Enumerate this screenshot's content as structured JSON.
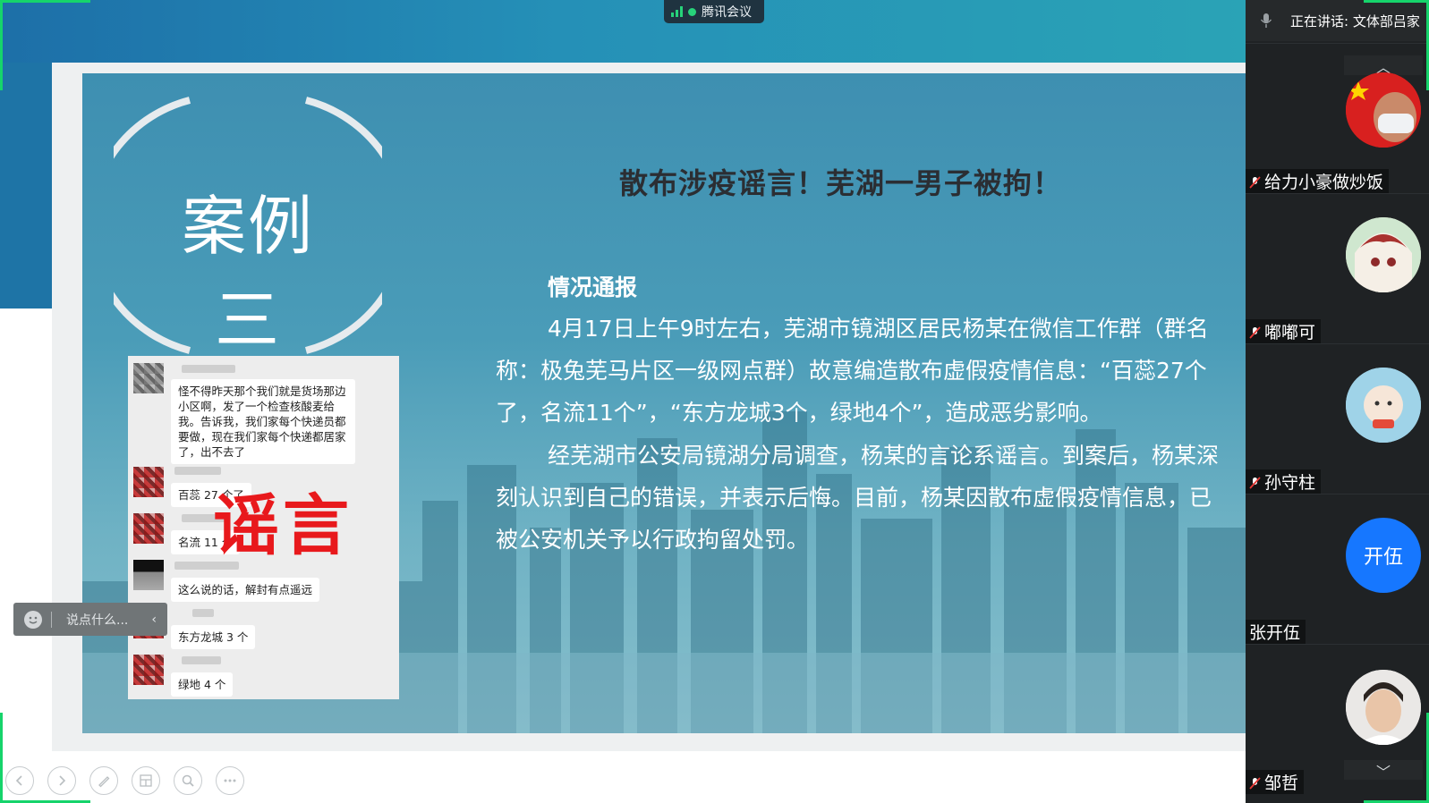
{
  "app": {
    "name": "腾讯会议"
  },
  "colors": {
    "accent_green": "#16d46b",
    "blue_avatar": "#1677ff",
    "rumor_red": "#e8191c"
  },
  "slide": {
    "case_title": "案例三",
    "headline": "散布涉疫谣言！芜湖一男子被拘！",
    "section_title": "情况通报",
    "paragraph1": "4月17日上午9时左右，芜湖市镜湖区居民杨某在微信工作群（群名称：极兔芜马片区一级网点群）故意编造散布虚假疫情信息：“百蕊27个了，名流11个”，“东方龙城3个，绿地4个”，造成恶劣影响。",
    "paragraph2": "经芜湖市公安局镜湖分局调查，杨某的言论系谣言。到案后，杨某深刻认识到自己的错误，并表示后悔。目前，杨某因散布虚假疫情信息，已被公安机关予以行政拘留处罚。",
    "chat": {
      "messages": [
        "怪不得昨天那个我们就是货场那边小区啊，发了一个检查核酸麦给我。告诉我，我们家每个快递员都要做，现在我们家每个快递都居家了，出不去了",
        "百蕊 27 个了",
        "名流 11 个",
        "这么说的话，解封有点遥远",
        "东方龙城 3 个",
        "绿地 4 个"
      ],
      "stamp": "谣言"
    }
  },
  "comment_box": {
    "placeholder": "说点什么..."
  },
  "toolbar": {
    "icons": [
      "prev-icon",
      "next-icon",
      "pen-icon",
      "layout-icon",
      "zoom-icon",
      "more-icon"
    ]
  },
  "panel": {
    "speaking_label": "正在讲话: 文体部吕家",
    "participants": [
      {
        "name": "给力小豪做炒饭",
        "muted": true,
        "avatar": "flag-mask"
      },
      {
        "name": "嘟嘟可",
        "muted": true,
        "avatar": "anime-girl"
      },
      {
        "name": "孙守柱",
        "muted": true,
        "avatar": "cartoon"
      },
      {
        "name": "张开伍",
        "muted": false,
        "avatar_text": "开伍"
      },
      {
        "name": "邹哲",
        "muted": true,
        "avatar": "photo"
      }
    ]
  }
}
